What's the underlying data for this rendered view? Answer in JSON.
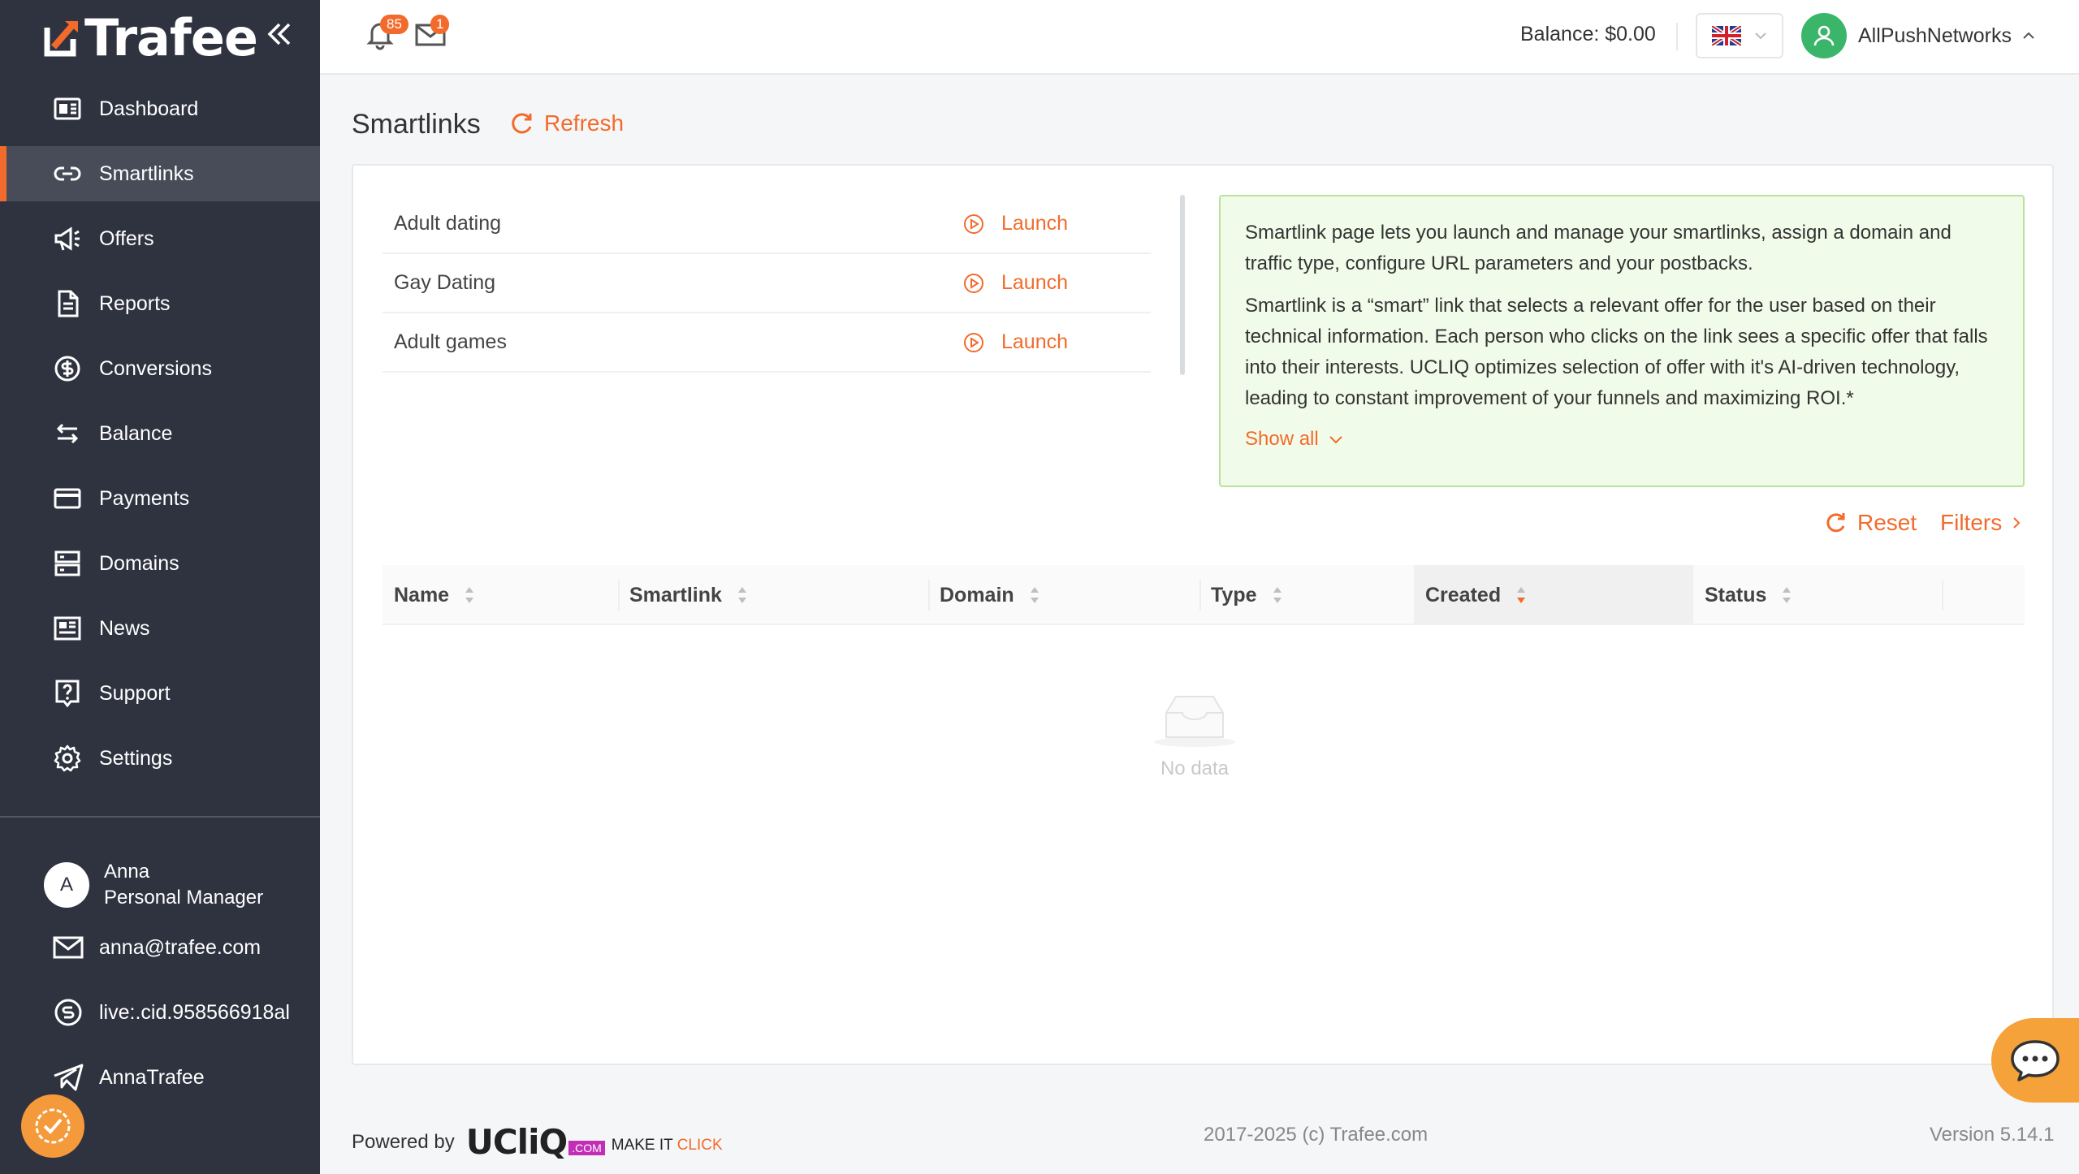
{
  "brand": {
    "logo_text": "Trafee"
  },
  "sidebar": {
    "items": [
      {
        "label": "Dashboard",
        "icon": "dashboard-icon"
      },
      {
        "label": "Smartlinks",
        "icon": "link-icon",
        "active": true
      },
      {
        "label": "Offers",
        "icon": "megaphone-icon"
      },
      {
        "label": "Reports",
        "icon": "document-icon"
      },
      {
        "label": "Conversions",
        "icon": "dollar-circle-icon"
      },
      {
        "label": "Balance",
        "icon": "swap-icon"
      },
      {
        "label": "Payments",
        "icon": "credit-card-icon"
      },
      {
        "label": "Domains",
        "icon": "server-icon"
      },
      {
        "label": "News",
        "icon": "newspaper-icon"
      },
      {
        "label": "Support",
        "icon": "question-icon"
      },
      {
        "label": "Settings",
        "icon": "gear-icon"
      }
    ],
    "manager": {
      "initial": "A",
      "name": "Anna",
      "role": "Personal Manager",
      "email": "anna@trafee.com",
      "skype": "live:.cid.958566918al",
      "telegram": "AnnaTrafee"
    }
  },
  "header": {
    "notifications_count": "85",
    "messages_count": "1",
    "balance": "Balance: $0.00",
    "language": "en-gb-flag",
    "user_name": "AllPushNetworks"
  },
  "main": {
    "title": "Smartlinks",
    "refresh_label": "Refresh",
    "launch_items": [
      {
        "name": "Adult dating",
        "action": "Launch"
      },
      {
        "name": "Gay Dating",
        "action": "Launch"
      },
      {
        "name": "Adult games",
        "action": "Launch"
      }
    ],
    "info": {
      "p1": "Smartlink page lets you launch and manage your smartlinks, assign a domain and traffic type, configure URL parameters and your postbacks.",
      "p2": "Smartlink is a “smart” link that selects a relevant offer for the user based on their technical information. Each person who clicks on the link sees a specific offer that falls into their interests. UCLIQ optimizes selection of offer with it's AI-driven technology, leading to constant improvement of your funnels and maximizing ROI.*",
      "show_all": "Show all"
    },
    "reset_label": "Reset",
    "filters_label": "Filters",
    "table": {
      "columns": [
        "Name",
        "Smartlink",
        "Domain",
        "Type",
        "Created",
        "Status"
      ],
      "sorted_column": "Created",
      "empty_text": "No data"
    }
  },
  "footer": {
    "powered_by": "Powered by",
    "brand": "UCliQ",
    "brand_suffix": ".COM",
    "tagline_1": "MAKE IT",
    "tagline_2": "CLICK",
    "copyright": "2017-2025 (c) Trafee.com",
    "version": "Version 5.14.1"
  },
  "colors": {
    "accent": "#f26b2c",
    "sidebar": "#2f3340",
    "info_bg": "#f1fbe9",
    "success": "#3bb56a"
  }
}
